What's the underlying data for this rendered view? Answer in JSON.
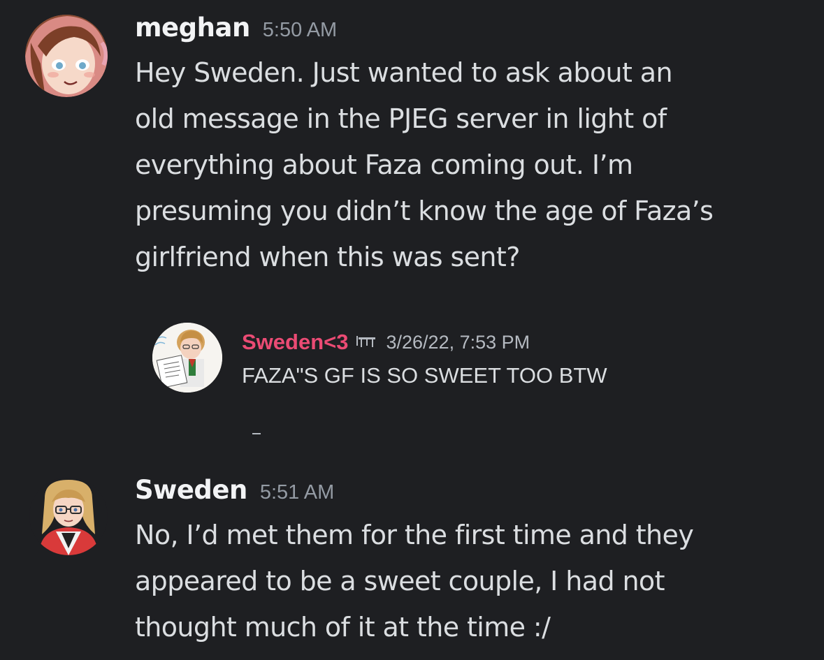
{
  "messages": [
    {
      "author": "meghan",
      "time": "5:50 AM",
      "text": "Hey Sweden. Just wanted to ask about an\nold message in the PJEG server in light of\neverything about Faza coming out. I’m\npresuming you didn’t know the age of Faza’s\ngirlfriend when this was sent?",
      "avatar_icon": "anime-girl-avatar-icon"
    },
    {
      "author": "Sweden",
      "time": "5:51 AM",
      "text": "No, I’d met them for the first time and they\nappeared to be a sweet couple, I had not\nthought much of it at the time :/",
      "avatar_icon": "anime-blonde-glasses-avatar-icon"
    }
  ],
  "quoted": {
    "author": "Sweden<3",
    "time": "3/26/22, 7:53 PM",
    "text": "FAZA\"S GF IS SO SWEET TOO BTW",
    "author_color": "#eb4b74",
    "badge_icon": "server-tag-icon"
  },
  "colors": {
    "background": "#1e1f22",
    "username": "#f2f3f5",
    "timestamp": "#949ba4",
    "message_text": "#dbdee1"
  }
}
